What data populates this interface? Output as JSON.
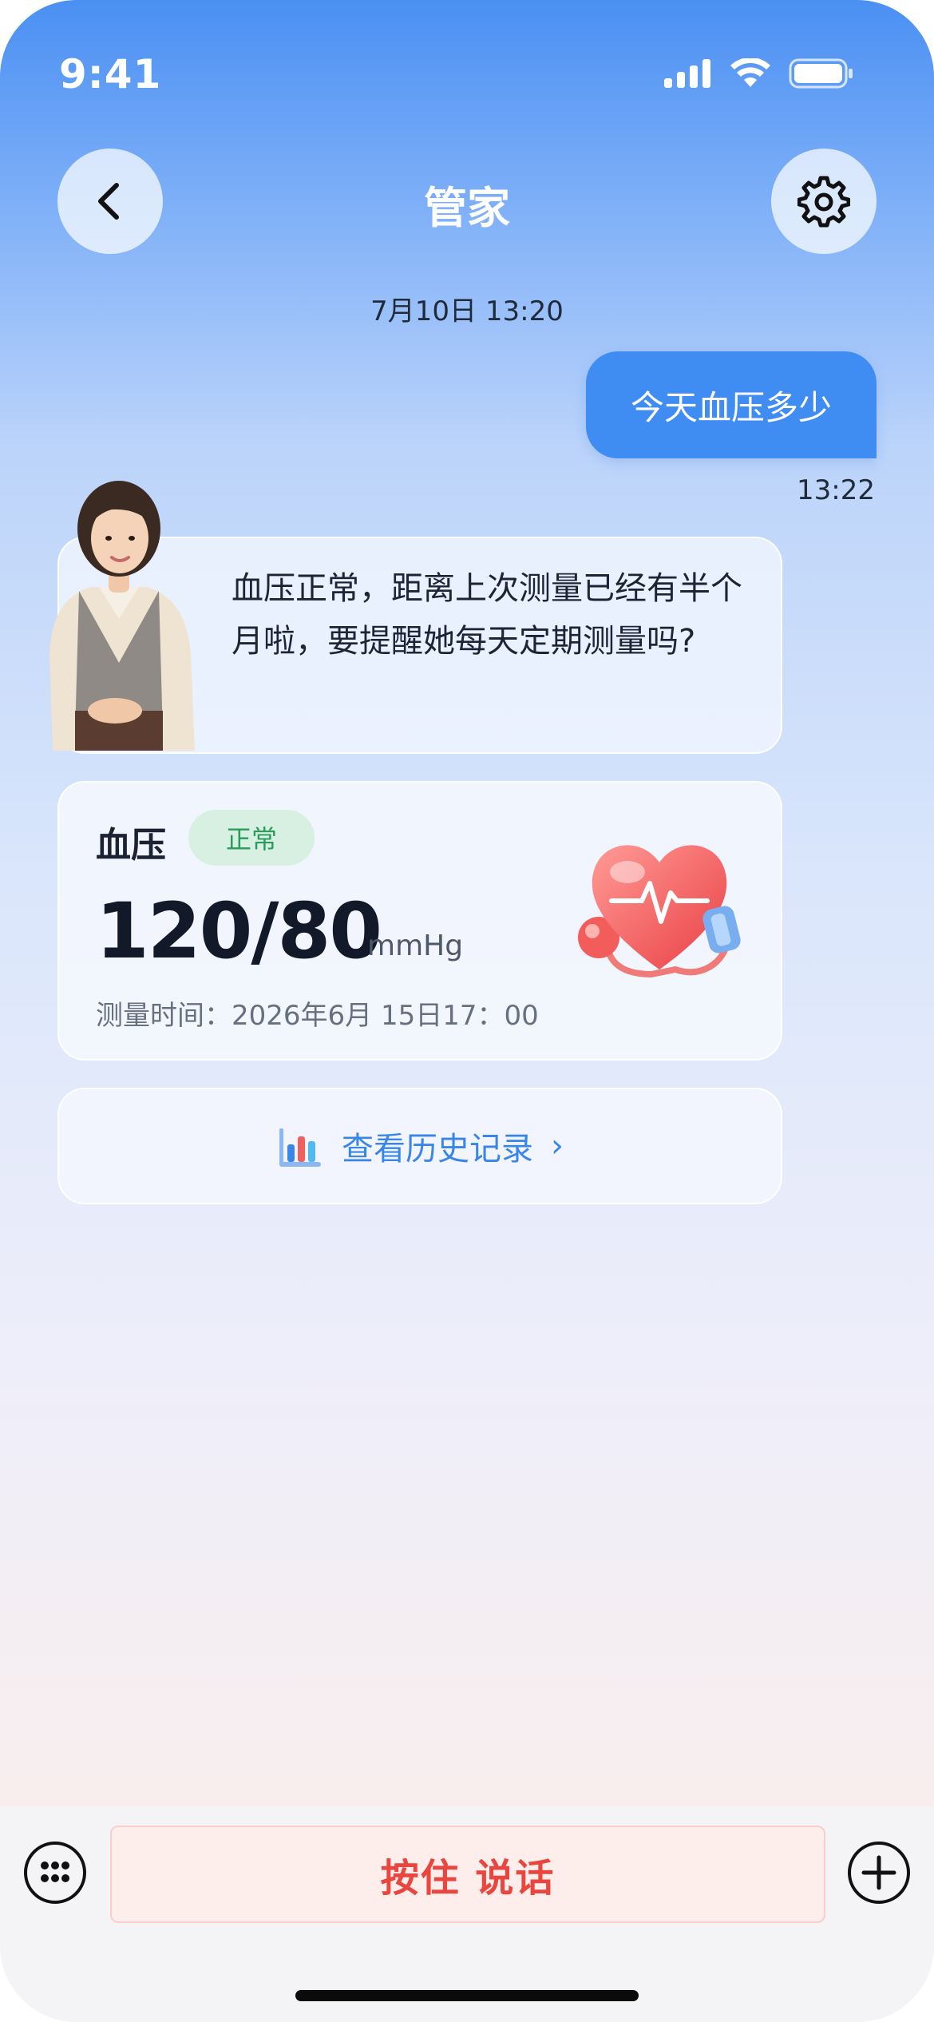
{
  "status_bar": {
    "time": "9:41",
    "icons": [
      "signal-icon",
      "wifi-icon",
      "battery-icon"
    ]
  },
  "header": {
    "title": "管家",
    "back_icon": "chevron-left-icon",
    "settings_icon": "gear-icon"
  },
  "chat": {
    "date_stamp": "7月10日 13:20",
    "user_message": "今天血压多少",
    "user_time": "13:22",
    "assistant_message": "血压正常，距离上次测量已经有半个月啦，要提醒她每天定期测量吗?"
  },
  "bp_card": {
    "label": "血压",
    "status": "正常",
    "value": "120/80",
    "unit": "mmHg",
    "measure_time": "测量时间：2026年6月 15日17：00"
  },
  "history": {
    "label": "查看历史记录",
    "icon": "bar-chart-icon",
    "chevron": "›"
  },
  "bottom_bar": {
    "hold_to_talk": "按住 说话",
    "left_icon": "keyboard-icon",
    "right_icon": "plus-icon"
  },
  "colors": {
    "accent": "#3f8cf2",
    "normal_badge_bg": "#d7f0e2",
    "normal_badge_text": "#2a9b5a",
    "talk_text": "#e8463e"
  }
}
